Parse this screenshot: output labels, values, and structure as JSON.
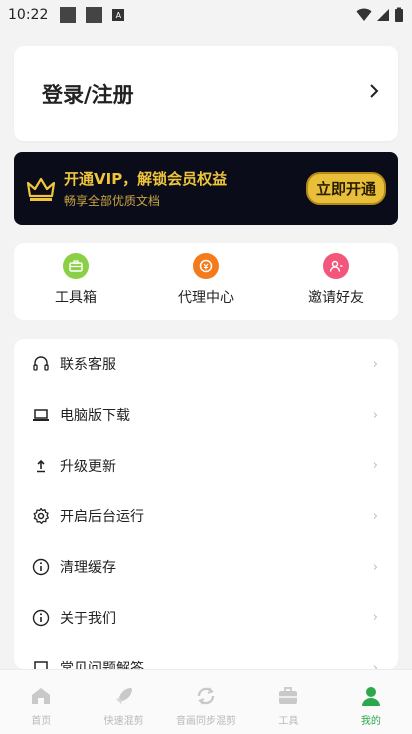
{
  "status_bar": {
    "time": "10:22",
    "notif_icon_label": "A"
  },
  "login": {
    "title": "登录/注册",
    "chevron": "›"
  },
  "vip": {
    "headline": "开通VIP，解锁会员权益",
    "subline": "畅享全部优质文档",
    "button": "立即开通",
    "accent_color": "#f0c53b",
    "bg_color": "#0b0c19"
  },
  "quick_tools": [
    {
      "label": "工具箱",
      "icon": "toolbox-icon",
      "color": "#8bcf46"
    },
    {
      "label": "代理中心",
      "icon": "agent-coin-icon",
      "color": "#f47b1c"
    },
    {
      "label": "邀请好友",
      "icon": "invite-friend-icon",
      "color": "#f2567a"
    }
  ],
  "menu_items": [
    {
      "label": "联系客服",
      "icon": "headset-icon"
    },
    {
      "label": "电脑版下载",
      "icon": "laptop-icon"
    },
    {
      "label": "升级更新",
      "icon": "upgrade-arrow-icon"
    },
    {
      "label": "开启后台运行",
      "icon": "gear-icon"
    },
    {
      "label": "清理缓存",
      "icon": "info-icon"
    },
    {
      "label": "关于我们",
      "icon": "info-icon"
    },
    {
      "label": "常见问题解答",
      "icon": "faq-icon"
    }
  ],
  "bottom_nav": [
    {
      "label": "首页",
      "icon": "home-icon",
      "active": false
    },
    {
      "label": "快速混剪",
      "icon": "rocket-icon",
      "active": false
    },
    {
      "label": "音画同步混剪",
      "icon": "sync-icon",
      "active": false
    },
    {
      "label": "工具",
      "icon": "toolbox-icon",
      "active": false
    },
    {
      "label": "我的",
      "icon": "profile-icon",
      "active": true
    }
  ],
  "colors": {
    "active_green": "#2ca84a",
    "inactive_gray": "#b8b8b8"
  }
}
